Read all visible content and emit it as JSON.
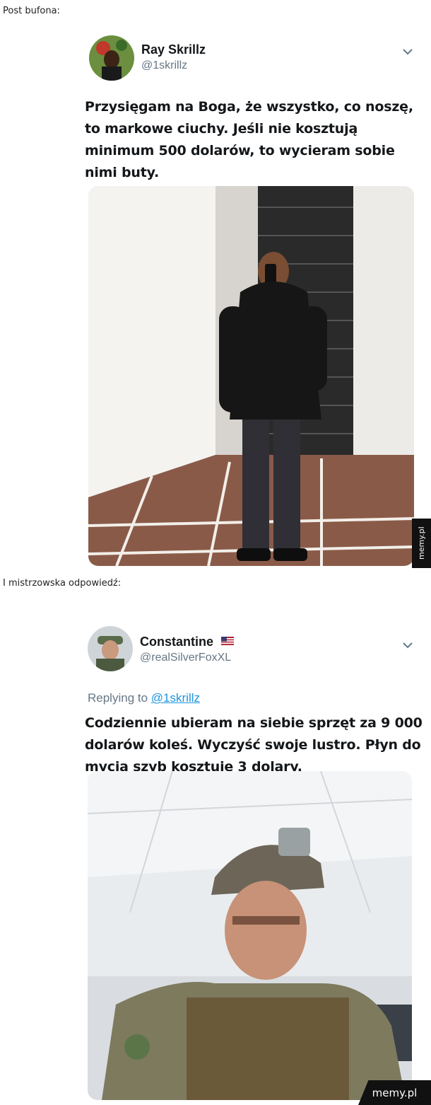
{
  "caption_top": "Post bufona:",
  "caption_middle": "I mistrzowska odpowiedź:",
  "tweet1": {
    "name": "Ray Skrillz",
    "handle": "@1skrillz",
    "lines": [
      "Przysięgam na Boga, że wszystko, co noszę,",
      "to markowe ciuchy. Jeśli nie kosztują",
      "minimum 500 dolarów, to wycieram sobie",
      "nimi buty."
    ]
  },
  "tweet2": {
    "name": "Constantine",
    "handle": "@realSilverFoxXL",
    "replying_label": "Replying to",
    "replying_handle": "@1skrillz",
    "lines": [
      "Codziennie ubieram na siebie sprzęt za 9 000",
      "dolarów koleś. Wyczyść swoje lustro. Płyn do",
      "mycia szyb kosztuje 3 dolary."
    ]
  },
  "watermark_side": "memy.pl",
  "watermark_corner": "memy.pl",
  "icons": {
    "chevron": "chevron-down-icon",
    "flag": "us-flag-icon"
  },
  "colors": {
    "name": "#14171a",
    "handle": "#657786",
    "mention": "#1b95e0"
  }
}
